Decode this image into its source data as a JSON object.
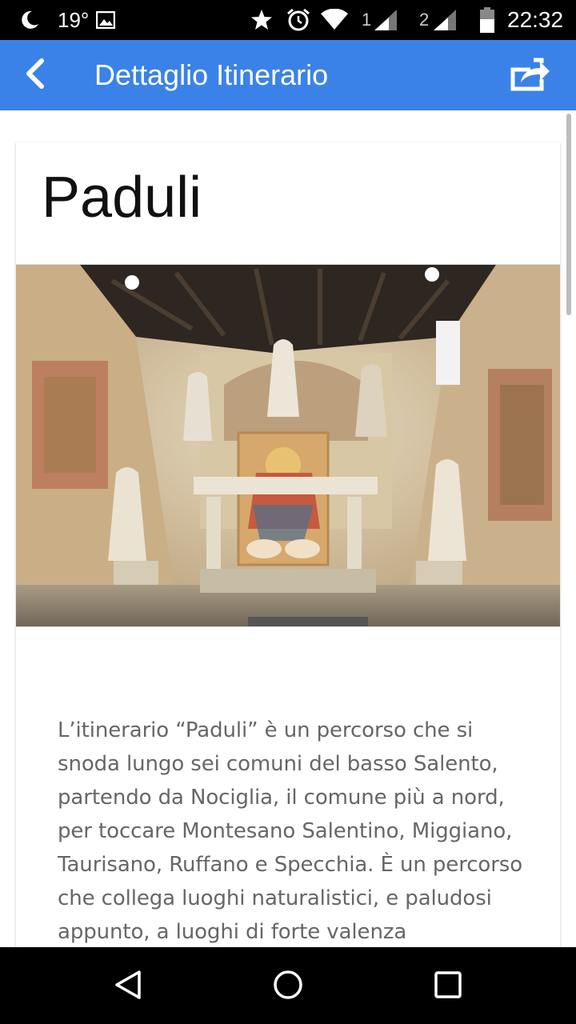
{
  "status_bar": {
    "temperature": "19°",
    "signal_1_label": "1",
    "signal_2_label": "2",
    "time": "22:32",
    "icons": [
      "moon-icon",
      "image-icon",
      "star-icon",
      "alarm-icon",
      "wifi-icon",
      "signal-icon",
      "battery-icon"
    ]
  },
  "app_bar": {
    "title": "Dettaglio Itinerario",
    "background_color": "#3b82e8",
    "icons": [
      "back-arrow-icon",
      "share-icon"
    ]
  },
  "card": {
    "title": "Paduli",
    "image_icon": "chapel-frescoes-photo",
    "description": "L’itinerario “Paduli” è un percorso che si snoda lungo sei comuni del basso Salento, partendo da Nociglia, il comune più a nord, per toccare Montesano Salentino, Miggiano, Taurisano, Ruffano e Specchia. È un percorso che collega luoghi naturalistici, e paludosi appunto, a luoghi di forte valenza"
  },
  "nav_bar": {
    "icons": [
      "back-triangle-icon",
      "home-circle-icon",
      "recents-square-icon"
    ]
  }
}
